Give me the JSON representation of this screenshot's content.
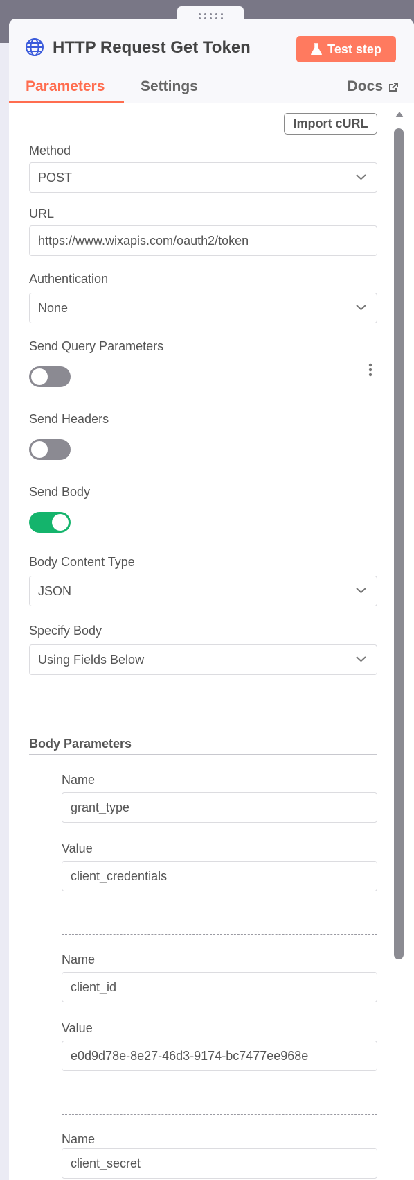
{
  "header": {
    "node_title": "HTTP Request Get Token",
    "test_button_label": "Test step",
    "accent_color": "#ff6d4f",
    "button_color": "#ff7a5f"
  },
  "tabs": [
    {
      "label": "Parameters",
      "active": true
    },
    {
      "label": "Settings",
      "active": false
    }
  ],
  "docs_label": "Docs",
  "import_curl_label": "Import cURL",
  "fields": {
    "method": {
      "label": "Method",
      "value": "POST"
    },
    "url": {
      "label": "URL",
      "value": "https://www.wixapis.com/oauth2/token"
    },
    "authentication": {
      "label": "Authentication",
      "value": "None"
    },
    "send_query": {
      "label": "Send Query Parameters",
      "enabled": false
    },
    "send_headers": {
      "label": "Send Headers",
      "enabled": false
    },
    "send_body": {
      "label": "Send Body",
      "enabled": true
    },
    "body_content_type": {
      "label": "Body Content Type",
      "value": "JSON"
    },
    "specify_body": {
      "label": "Specify Body",
      "value": "Using Fields Below"
    }
  },
  "body_parameters": {
    "heading": "Body Parameters",
    "items": [
      {
        "name_label": "Name",
        "name": "grant_type",
        "value_label": "Value",
        "value": "client_credentials"
      },
      {
        "name_label": "Name",
        "name": "client_id",
        "value_label": "Value",
        "value": "e0d9d78e-8e27-46d3-9174-bc7477ee968e"
      },
      {
        "name_label": "Name",
        "name": "client_secret"
      }
    ]
  },
  "colors": {
    "toggle_on": "#14b46c",
    "toggle_off": "#8b8a92"
  },
  "icons": [
    "globe-icon",
    "flask-icon",
    "external-link-icon",
    "chevron-down-icon",
    "vertical-dots-icon",
    "drag-handle-icon"
  ]
}
